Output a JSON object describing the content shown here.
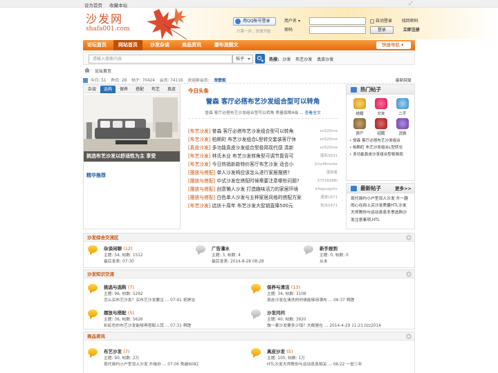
{
  "topbar": {
    "set_home": "设为首页",
    "bookmark": "收藏本站"
  },
  "logo": {
    "cn": "沙发网",
    "en": "shafa001.com"
  },
  "qq": {
    "button": "用QQ帐号登录",
    "tip": "只需一步，快速开始"
  },
  "login": {
    "user_label": "用户名",
    "user_select_arrow": "▾",
    "pass_label": "密码",
    "auto": "自动登录",
    "forgot": "找回密码",
    "login_btn": "登录",
    "register": "立即注册"
  },
  "nav": {
    "items": [
      "论坛首页",
      "网站首页",
      "沙发杂谈",
      "商品资讯",
      "瀑布流图文"
    ],
    "active": 1,
    "quick": "快捷导航"
  },
  "search": {
    "placeholder": "请输入搜索内容",
    "type": "帖子",
    "hot_label": "热搜:",
    "hot": [
      "沙发",
      "布艺沙发",
      "真皮沙发"
    ]
  },
  "breadcrumb": {
    "text": "论坛首页"
  },
  "stats": {
    "today": "今日: 51",
    "yesterday": "昨日: 28",
    "posts": "帖子: 70424",
    "members": "会员: 74116",
    "welcome": "欢迎新会员:",
    "newbie": "宠壁枢",
    "latest": "最新回复"
  },
  "left": {
    "tabs": [
      "杂谈",
      "选购",
      "保养",
      "搭配",
      "布艺",
      "真皮"
    ],
    "active": 1,
    "caption": "挑选布艺沙发以舒适性为主 享受",
    "featured": "精华推荐"
  },
  "headline": {
    "label": "今日头条",
    "title": "誉森 客厅必搭布艺沙发组合型可以转角",
    "desc": "誉森 客厅必搭布艺沙发组合型可以转角 质量保障A级 ...",
    "more": "查看全文"
  },
  "news": [
    {
      "cat": "[布艺沙发]",
      "title": "誉森 客厅必搭布艺沙发组合型可以转角",
      "au": "xx520me"
    },
    {
      "cat": "[布艺沙发]",
      "title": "柏斯町 布艺沙发组合L型转交套装客厅休",
      "au": "xx520me"
    },
    {
      "cat": "[真皮沙发]",
      "title": "多功能真皮沙发组合型极简现代感 清新",
      "au": "xx520me"
    },
    {
      "cat": "[布艺沙发]",
      "title": "林氏木业 布艺沙发转角型可调节靠背可",
      "au": "蔻和3631"
    },
    {
      "cat": "[布艺沙发]",
      "title": "今日热销新款特价客厅布艺沙发 适合小",
      "au": "2cly46mnke"
    },
    {
      "cat": "[摆放与搭配]",
      "title": "单人沙发椅应该怎么进行家居摆搭?",
      "au": "漫游者"
    },
    {
      "cat": "[摆放与搭配]",
      "title": "中式沙发在搭配时候需要注意哪些问题?",
      "au": "37536988i"
    },
    {
      "cat": "[摆放与搭配]",
      "title": "创意懒人沙发 打造趣味活力的家居环境",
      "au": "kfeguogshv"
    },
    {
      "cat": "[摆放与搭配]",
      "title": "白色单人沙发与五种家居风格的搭配方案",
      "au": "漫游1871"
    },
    {
      "cat": "[布艺沙发]",
      "title": "店庆十周年 布艺沙发大促销直降500元",
      "au": "怕水0471"
    }
  ],
  "hot": {
    "title": "热门帖子",
    "icons": [
      "结婚",
      "交友",
      "二手",
      "房产",
      "招聘",
      "消费"
    ],
    "list": [
      "誉森 客厅必搭布艺沙发组合",
      "柏斯町 布艺沙发组合L型转交",
      "多功能真皮沙发组合型极简现"
    ]
  },
  "newest": {
    "title": "最新帖子",
    "more": "更多>>",
    "text": "现代简约小户型双人沙发 升一趣雨心在网上买沙发质量HTL沙发大师教你与运动息息冬季选购沙发注意事项,HTL"
  },
  "sections": [
    {
      "title": "沙发综合交流区",
      "forums": [
        {
          "name": "杂谈闲聊",
          "count": "(12)",
          "stat": "主题: 54, 帖数: 1512",
          "last": "最后发表: 07:30",
          "gray": false
        },
        {
          "name": "广告灌水",
          "count": "",
          "stat": "主题: 3, 帖数: 4",
          "last": "最后发表: 2014-8-28 08:28",
          "gray": true
        },
        {
          "name": "新手报到",
          "count": "",
          "stat": "主题: 0, 帖数: 0",
          "last": "从未",
          "gray": true
        }
      ]
    },
    {
      "title": "沙发知识交流",
      "forums": [
        {
          "name": "挑选与选购",
          "count": "(7)",
          "stat": "主题: 96, 帖数: 5292",
          "last": "怎么买布艺沙发？买布艺沙发要注 ... 07:41 祝婷洁",
          "gray": false
        },
        {
          "name": "保养与清洁",
          "count": "(13)",
          "stat": "主题: 34, 帖数: 3108",
          "last": "真皮沙发在清洗的时候能够用漂布 ... 06:37 啊蹉",
          "gray": false
        },
        {
          "name": "摆放与搭配",
          "count": "(5)",
          "stat": "主题: 36, 帖数: 5626",
          "last": "彩虹色的布艺沙发能够再搭配上其 ... 07:31 啊蹉",
          "gray": false
        },
        {
          "name": "沙发问问",
          "count": "",
          "stat": "主题: 40, 帖数: 3920",
          "last": "做一套沙发要多少钱？大概是在 ... 2014-4-29 11:21 lizz2014",
          "gray": true
        }
      ]
    },
    {
      "title": "商品资讯",
      "forums": [
        {
          "name": "布艺沙发",
          "count": "(7)",
          "stat": "主题: 90, 帖数: 2万",
          "last": "现代简约小户型双人沙发 升格你 ... 07:06 秀越6082",
          "gray": false
        },
        {
          "name": "真皮沙发",
          "count": "(5)",
          "stat": "主题: 100, 帖数: 1万",
          "last": "HTL沙发大师教你与运动息息相关 ... 06:22 一觉三年",
          "gray": false
        }
      ]
    }
  ]
}
